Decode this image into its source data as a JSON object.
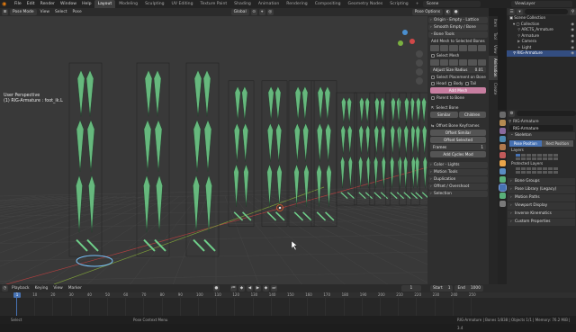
{
  "menubar": {
    "menus": [
      "File",
      "Edit",
      "Render",
      "Window",
      "Help"
    ],
    "workspaces": [
      "Layout",
      "Modeling",
      "Sculpting",
      "UV Editing",
      "Texture Paint",
      "Shading",
      "Animation",
      "Rendering",
      "Compositing",
      "Geometry Nodes",
      "Scripting"
    ],
    "active_workspace": "Layout",
    "scene": "Scene",
    "view_layer": "ViewLayer"
  },
  "viewport_header": {
    "mode": "Pose Mode",
    "menus": [
      "View",
      "Select",
      "Pose"
    ],
    "orientation": "Global",
    "pose_options": "Pose Options"
  },
  "viewport": {
    "perspective": "User Perspective",
    "object": "(1) RIG-Armature : foot_ik.L"
  },
  "npanel": {
    "origin_header": "Origin - Empty - Lattice",
    "smooth_header": "Smooth Empty / Bone",
    "bone_tools_header": "Bone Tools",
    "add_mesh": "Add Mesh to Selected Bones",
    "select_mesh": "Select Mesh",
    "adjust_radius": "Adjust Size Radius",
    "adjust_value": "0.01",
    "select_placement": "Select Placement on Bone",
    "placements": [
      "Head",
      "Body",
      "Tail"
    ],
    "add_mesh_btn": "Add Mesh",
    "parent_to_bone": "Parent to Bone",
    "select_bone": "Select Bone",
    "similar": "Similar",
    "children": "Children",
    "offset_keyframes": "Offset Bone Keyframes",
    "offset_similar": "Offset Similar",
    "offset_selected": "Offset Selected",
    "frames_label": "Frames",
    "frames_value": "1",
    "add_cycles": "Add Cycles Mod",
    "collapsed": [
      "Color - Lights",
      "Motion Tools",
      "Duplication",
      "Offset / Overshoot",
      "Selection"
    ],
    "tabs": [
      "Item",
      "Tool",
      "View",
      "Animation",
      "Create"
    ]
  },
  "outliner": {
    "rows": [
      {
        "label": "Scene Collection",
        "level": 0,
        "selected": false
      },
      {
        "label": "Collection",
        "level": 1,
        "selected": false
      },
      {
        "label": "ARCTS_Armature",
        "level": 2,
        "selected": false
      },
      {
        "label": "Armature",
        "level": 2,
        "selected": false
      },
      {
        "label": "Camera",
        "level": 2,
        "selected": false
      },
      {
        "label": "Light",
        "level": 2,
        "selected": false
      },
      {
        "label": "RIG-Armature",
        "level": 1,
        "selected": true
      }
    ]
  },
  "properties": {
    "breadcrumb": "RIG-Armature",
    "object_name": "RIG-Armature",
    "skeleton_header": "Skeleton",
    "pose_position": "Pose Position",
    "rest_position": "Rest Position",
    "layers_label": "Layers",
    "protected_layers_label": "Protected Layers",
    "collapsed": [
      "Bone Groups",
      "Pose Library (Legacy)",
      "Motion Paths",
      "Viewport Display",
      "Inverse Kinematics",
      "Custom Properties"
    ]
  },
  "timeline": {
    "menus": [
      "Playback",
      "Keying",
      "View",
      "Marker"
    ],
    "current_frame": "1",
    "start_label": "Start",
    "start": "1",
    "end_label": "End",
    "end": "1000",
    "ticks": [
      "0",
      "10",
      "20",
      "30",
      "40",
      "50",
      "60",
      "70",
      "80",
      "90",
      "100",
      "110",
      "120",
      "130",
      "140",
      "150",
      "160",
      "170",
      "180",
      "190",
      "200",
      "210",
      "220",
      "230",
      "240",
      "250"
    ]
  },
  "statusbar": {
    "left": "Select",
    "middle": "Pose Context Menu",
    "right": "RIG-Armature | Bones 1/838 | Objects 1/1 | Memory: 76.2 MiB | 3.4"
  },
  "colors": {
    "accent": "#4772b3",
    "bone_green": "#6fcf8a",
    "select_orange": "#e87d0d",
    "pink_button": "#c77ea0"
  }
}
